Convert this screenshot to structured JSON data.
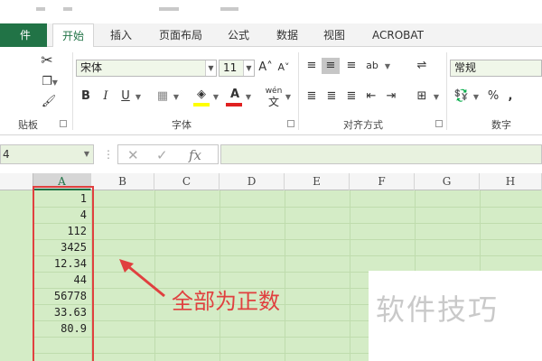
{
  "ribbon_tabs": [
    {
      "label": "件",
      "state": "file"
    },
    {
      "label": "开始",
      "state": "active"
    },
    {
      "label": "插入",
      "state": ""
    },
    {
      "label": "页面布局",
      "state": ""
    },
    {
      "label": "公式",
      "state": ""
    },
    {
      "label": "数据",
      "state": ""
    },
    {
      "label": "视图",
      "state": ""
    },
    {
      "label": "ACROBAT",
      "state": ""
    }
  ],
  "clipboard": {
    "group_label": "贴板",
    "cut_icon": "scissors-icon",
    "copy_icon": "copy-icon",
    "format_painter_icon": "brush-icon"
  },
  "font": {
    "group_label": "字体",
    "font_name": "宋体",
    "font_size": "11",
    "grow_label": "A˄",
    "shrink_label": "A˅",
    "bold_label": "B",
    "italic_label": "I",
    "underline_label": "U",
    "font_color_label": "A",
    "wen_label": "wén",
    "wen_sub_label": "文",
    "highlight_color": "#ffff00",
    "font_color": "#e02020"
  },
  "alignment": {
    "group_label": "对齐方式",
    "orientation_label": "ab"
  },
  "number": {
    "group_label": "数字",
    "format_value": "常规",
    "percent_label": "%",
    "comma_label": ","
  },
  "formula_bar": {
    "namebox_value": "4",
    "fx_label": "fx",
    "cancel_label": "✕",
    "enter_label": "✓"
  },
  "grid": {
    "columns": [
      "A",
      "B",
      "C",
      "D",
      "E",
      "F",
      "G",
      "H"
    ],
    "selected_column": "A",
    "column_a_values": [
      "1",
      "4",
      "112",
      "3425",
      "12.34",
      "44",
      "56778",
      "33.63",
      "80.9"
    ],
    "fill_color": "#d4ecc6"
  },
  "annotation": {
    "text": "全部为正数",
    "color": "#e0403f"
  },
  "watermark": {
    "text": "软件技巧"
  }
}
